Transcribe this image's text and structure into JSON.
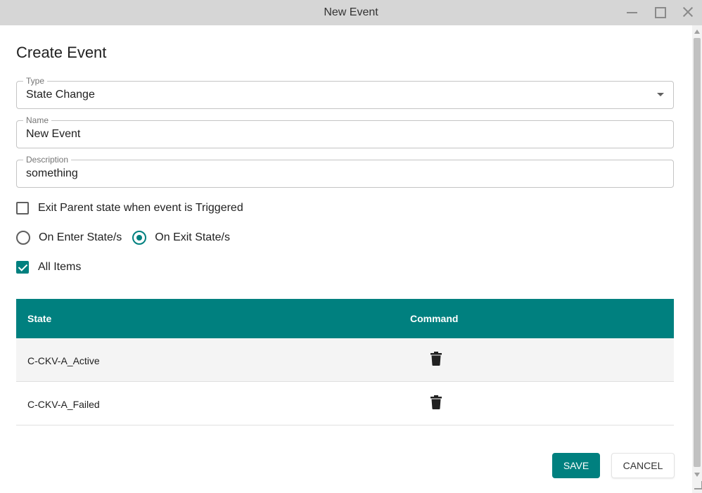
{
  "window": {
    "title": "New Event",
    "controls": [
      "minimize-icon",
      "maximize-icon",
      "close-icon"
    ]
  },
  "form": {
    "heading": "Create Event",
    "type": {
      "label": "Type",
      "value": "State Change"
    },
    "name": {
      "label": "Name",
      "value": "New Event"
    },
    "description": {
      "label": "Description",
      "value": "something"
    },
    "exit_parent": {
      "label": "Exit Parent state when event is Triggered",
      "checked": false
    },
    "trigger": {
      "options": [
        {
          "label": "On Enter State/s",
          "selected": false
        },
        {
          "label": "On Exit State/s",
          "selected": true
        }
      ]
    },
    "all_items": {
      "label": "All Items",
      "checked": true
    }
  },
  "table": {
    "columns": [
      "State",
      "Command"
    ],
    "rows": [
      {
        "state": "C-CKV-A_Active",
        "command_icon": "trash-icon"
      },
      {
        "state": "C-CKV-A_Failed",
        "command_icon": "trash-icon"
      }
    ]
  },
  "actions": {
    "save_label": "SAVE",
    "cancel_label": "CANCEL"
  },
  "colors": {
    "accent": "#00807f",
    "titlebar": "#d6d6d6"
  }
}
